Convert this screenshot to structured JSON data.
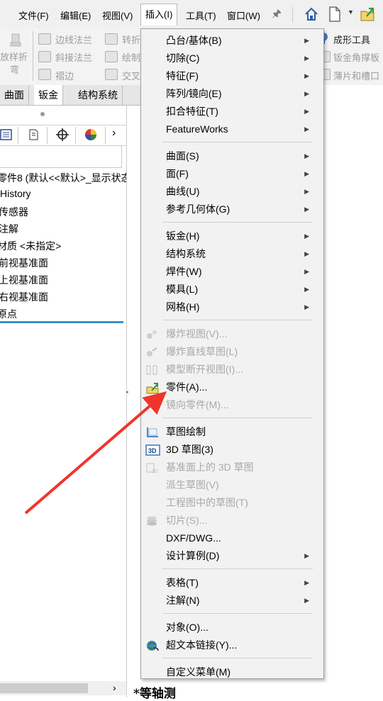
{
  "menubar": {
    "items": [
      "文件(F)",
      "编辑(E)",
      "视图(V)",
      "插入(I)",
      "工具(T)",
      "窗口(W)"
    ]
  },
  "ribbon": {
    "left_labels": [
      "放样折",
      "弯"
    ],
    "col2": [
      "边线法兰",
      "斜接法兰",
      "褶边"
    ],
    "col3": [
      "转折",
      "绘制",
      "交叉"
    ],
    "right": [
      "成形工具",
      "钣金角撑板",
      "薄片和槽口"
    ]
  },
  "tabs": [
    "曲面",
    "钣金",
    "结构系统"
  ],
  "tree": {
    "header": "零件8 (默认<<默认>_显示状态",
    "items": [
      "History",
      "传感器",
      "注解",
      "材质 <未指定>",
      "前视基准面",
      "上视基准面",
      "右视基准面",
      "原点"
    ]
  },
  "viewport": {
    "view_label": "*等轴测"
  },
  "dropdown": {
    "groups": [
      [
        {
          "label": "凸台/基体(B)",
          "sub": true,
          "disabled": false,
          "icon": ""
        },
        {
          "label": "切除(C)",
          "sub": true,
          "disabled": false,
          "icon": ""
        },
        {
          "label": "特征(F)",
          "sub": true,
          "disabled": false,
          "icon": ""
        },
        {
          "label": "阵列/镜向(E)",
          "sub": true,
          "disabled": false,
          "icon": ""
        },
        {
          "label": "扣合特征(T)",
          "sub": true,
          "disabled": false,
          "icon": ""
        },
        {
          "label": "FeatureWorks",
          "sub": true,
          "disabled": false,
          "icon": ""
        }
      ],
      [
        {
          "label": "曲面(S)",
          "sub": true,
          "disabled": false,
          "icon": ""
        },
        {
          "label": "面(F)",
          "sub": true,
          "disabled": false,
          "icon": ""
        },
        {
          "label": "曲线(U)",
          "sub": true,
          "disabled": false,
          "icon": ""
        },
        {
          "label": "参考几何体(G)",
          "sub": true,
          "disabled": false,
          "icon": ""
        }
      ],
      [
        {
          "label": "钣金(H)",
          "sub": true,
          "disabled": false,
          "icon": ""
        },
        {
          "label": "结构系统",
          "sub": true,
          "disabled": false,
          "icon": ""
        },
        {
          "label": "焊件(W)",
          "sub": true,
          "disabled": false,
          "icon": ""
        },
        {
          "label": "模具(L)",
          "sub": true,
          "disabled": false,
          "icon": ""
        },
        {
          "label": "网格(H)",
          "sub": true,
          "disabled": false,
          "icon": ""
        }
      ],
      [
        {
          "label": "爆炸视图(V)...",
          "sub": false,
          "disabled": true,
          "icon": "explode-view-icon"
        },
        {
          "label": "爆炸直线草图(L)",
          "sub": false,
          "disabled": true,
          "icon": "explode-line-icon"
        },
        {
          "label": "模型断开视图(I)...",
          "sub": false,
          "disabled": true,
          "icon": "break-view-icon"
        },
        {
          "label": "零件(A)...",
          "sub": false,
          "disabled": false,
          "icon": "part-icon"
        },
        {
          "label": "镜向零件(M)...",
          "sub": false,
          "disabled": true,
          "icon": ""
        }
      ],
      [
        {
          "label": "草图绘制",
          "sub": false,
          "disabled": false,
          "icon": "sketch-icon"
        },
        {
          "label": "3D 草图(3)",
          "sub": false,
          "disabled": false,
          "icon": "3d-sketch-icon"
        },
        {
          "label": "基准面上的 3D 草图",
          "sub": false,
          "disabled": true,
          "icon": "3d-sketch-plane-icon"
        },
        {
          "label": "派生草图(V)",
          "sub": false,
          "disabled": true,
          "icon": ""
        },
        {
          "label": "工程图中的草图(T)",
          "sub": false,
          "disabled": true,
          "icon": ""
        },
        {
          "label": "切片(S)...",
          "sub": false,
          "disabled": true,
          "icon": "slice-icon"
        },
        {
          "label": "DXF/DWG...",
          "sub": false,
          "disabled": false,
          "icon": ""
        },
        {
          "label": "设计算例(D)",
          "sub": true,
          "disabled": false,
          "icon": ""
        }
      ],
      [
        {
          "label": "表格(T)",
          "sub": true,
          "disabled": false,
          "icon": ""
        },
        {
          "label": "注解(N)",
          "sub": true,
          "disabled": false,
          "icon": ""
        }
      ],
      [
        {
          "label": "对象(O)...",
          "sub": false,
          "disabled": false,
          "icon": ""
        },
        {
          "label": "超文本链接(Y)...",
          "sub": false,
          "disabled": false,
          "icon": "hyperlink-icon"
        }
      ],
      [
        {
          "label": "自定义菜单(M)",
          "sub": false,
          "disabled": false,
          "icon": ""
        }
      ]
    ]
  },
  "annotation": {
    "arrow_color": "#f0342c"
  }
}
